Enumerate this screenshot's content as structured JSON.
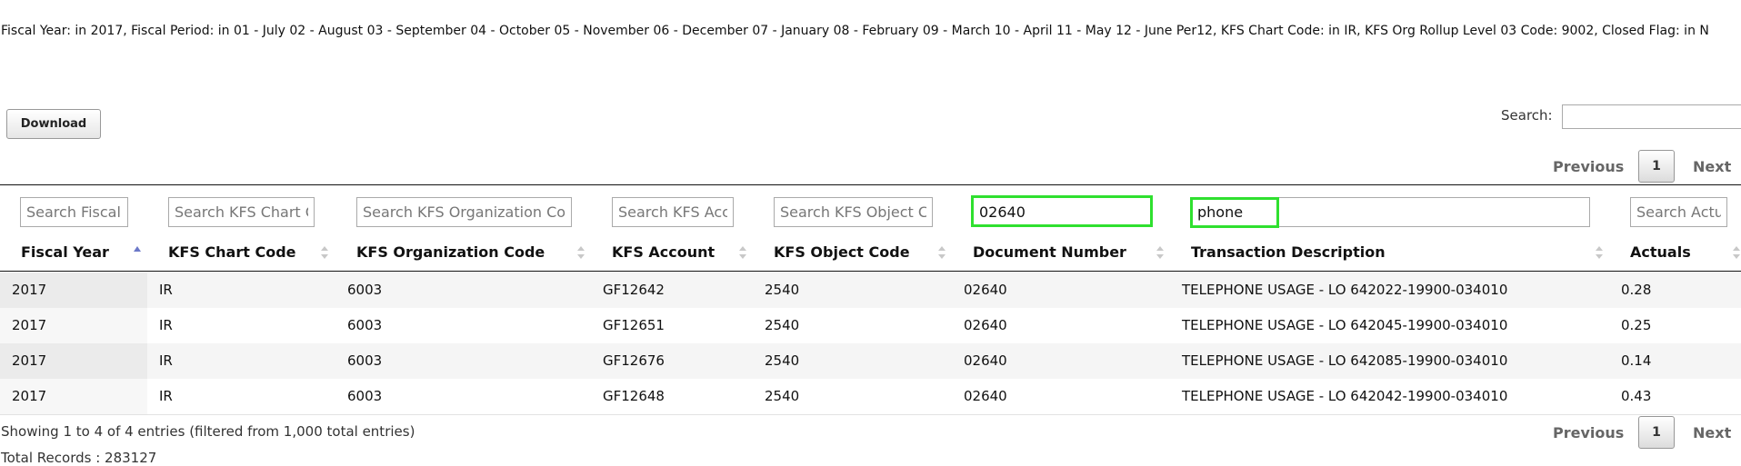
{
  "filter_summary": "Fiscal Year: in 2017, Fiscal Period: in 01 - July 02 - August 03 - September 04 - October 05 - November 06 - December 07 - January 08 - February 09 - March 10 - April 11 - May 12 - June Per12, KFS Chart Code: in IR, KFS Org Rollup Level 03 Code: 9002, Closed Flag: in N",
  "toolbar": {
    "download_label": "Download",
    "search_label": "Search:",
    "search_value": ""
  },
  "pagination": {
    "previous": "Previous",
    "next": "Next",
    "current_page": "1"
  },
  "columns": [
    {
      "label": "Fiscal Year",
      "placeholder": "Search Fiscal",
      "value": "",
      "sort": "asc"
    },
    {
      "label": "KFS Chart Code",
      "placeholder": "Search KFS Chart C",
      "value": "",
      "sort": "none"
    },
    {
      "label": "KFS Organization Code",
      "placeholder": "Search KFS Organization Cod",
      "value": "",
      "sort": "none"
    },
    {
      "label": "KFS Account",
      "placeholder": "Search KFS Acc",
      "value": "",
      "sort": "none"
    },
    {
      "label": "KFS Object Code",
      "placeholder": "Search KFS Object Cc",
      "value": "",
      "sort": "none"
    },
    {
      "label": "Document Number",
      "placeholder": "",
      "value": "02640",
      "sort": "none"
    },
    {
      "label": "Transaction Description",
      "placeholder": "",
      "value": "phone",
      "sort": "none"
    },
    {
      "label": "Actuals",
      "placeholder": "Search Actua",
      "value": "",
      "sort": "none"
    }
  ],
  "rows": [
    [
      "2017",
      "IR",
      "6003",
      "GF12642",
      "2540",
      "02640",
      "TELEPHONE USAGE - LO 642022-19900-034010",
      "0.28"
    ],
    [
      "2017",
      "IR",
      "6003",
      "GF12651",
      "2540",
      "02640",
      "TELEPHONE USAGE - LO 642045-19900-034010",
      "0.25"
    ],
    [
      "2017",
      "IR",
      "6003",
      "GF12676",
      "2540",
      "02640",
      "TELEPHONE USAGE - LO 642085-19900-034010",
      "0.14"
    ],
    [
      "2017",
      "IR",
      "6003",
      "GF12648",
      "2540",
      "02640",
      "TELEPHONE USAGE - LO 642042-19900-034010",
      "0.43"
    ]
  ],
  "info": "Showing 1 to 4 of 4 entries (filtered from 1,000 total entries)",
  "total_records": "Total Records : 283127",
  "colors": {
    "highlight": "#2fe02f",
    "sort_active": "#6b78c8",
    "sort_inactive": "#c8c8c8"
  },
  "icons": {
    "sort_ascending": "sort-ascending-icon",
    "sort_both": "sort-both-icon"
  }
}
